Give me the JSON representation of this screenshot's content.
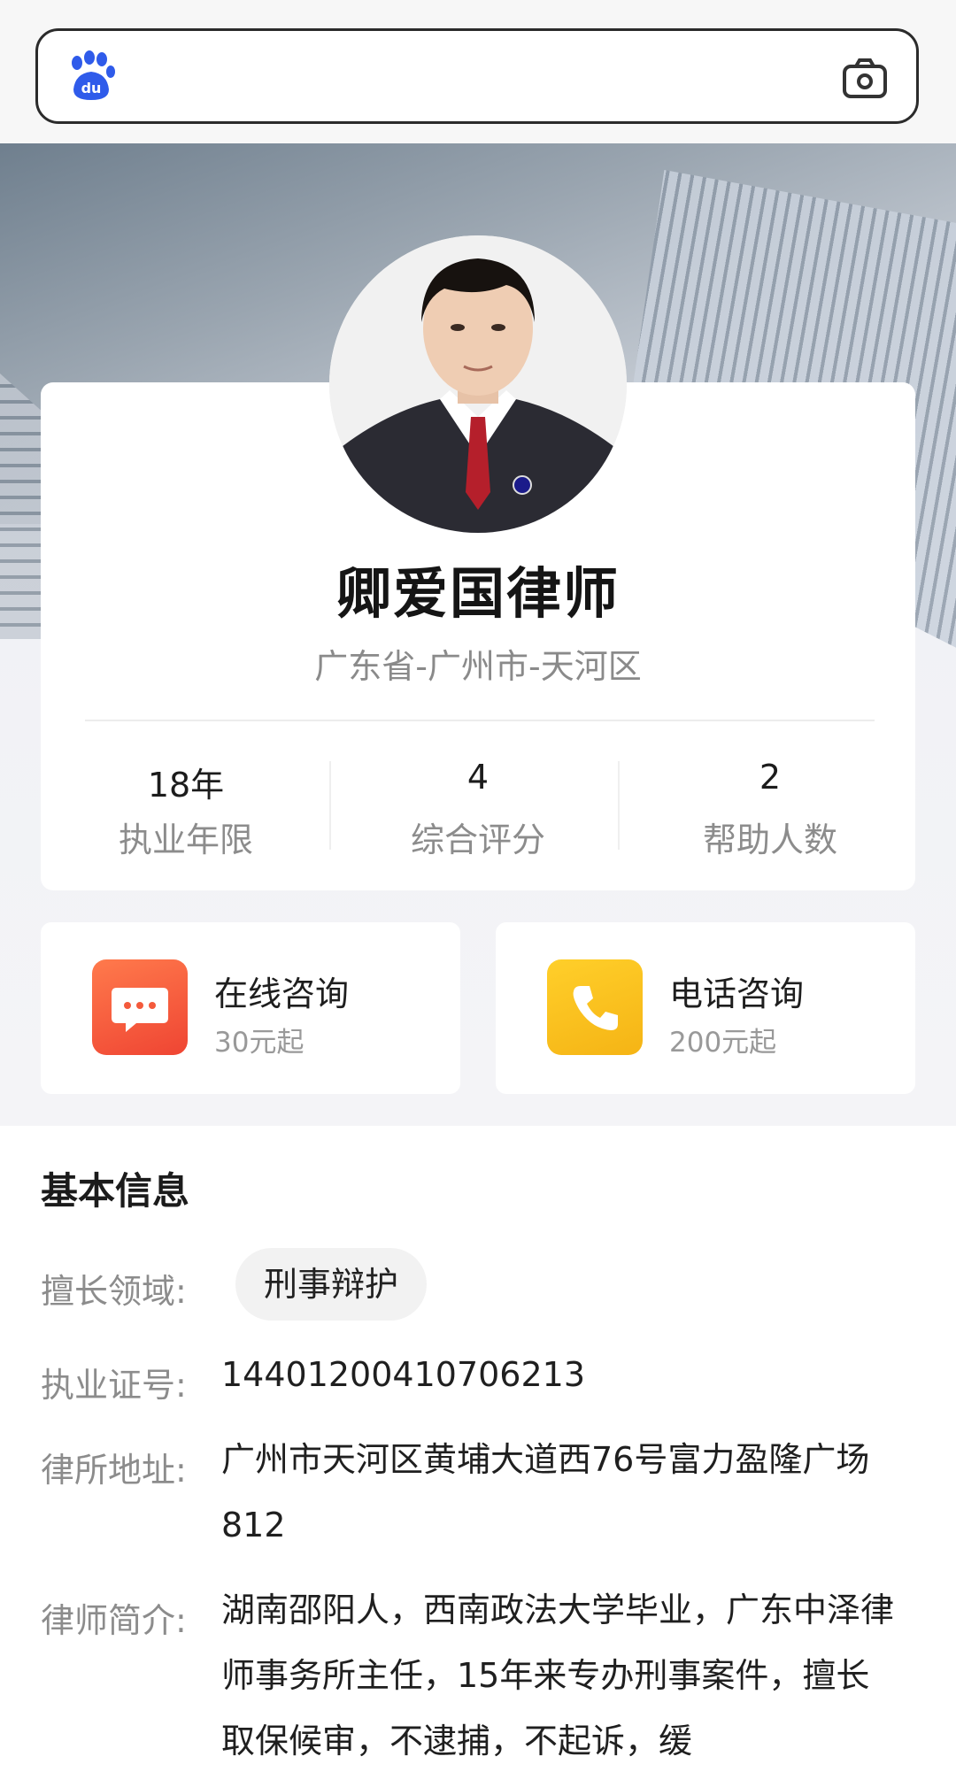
{
  "search": {
    "logo_icon": "baidu-paw-icon",
    "camera_icon": "camera-icon",
    "border_color": "#2b2b2b"
  },
  "profile": {
    "name": "卿爱国律师",
    "region": "广东省-广州市-天河区",
    "stats": [
      {
        "value": "18年",
        "label": "执业年限"
      },
      {
        "value": "4",
        "label": "综合评分"
      },
      {
        "value": "2",
        "label": "帮助人数"
      }
    ]
  },
  "consult": [
    {
      "title": "在线咨询",
      "price": "30元起",
      "icon": "chat-bubble-icon",
      "color": "#f45a3c"
    },
    {
      "title": "电话咨询",
      "price": "200元起",
      "icon": "phone-icon",
      "color": "#f7be1a"
    }
  ],
  "basic_info": {
    "title": "基本信息",
    "field_label": "擅长领域:",
    "field_tag": "刑事辩护",
    "license_label": "执业证号:",
    "license_value": "14401200410706213",
    "address_label": "律所地址:",
    "address_value": "广州市天河区黄埔大道西76号富力盈隆广场812",
    "intro_label": "律师简介:",
    "intro_value": "湖南邵阳人，西南政法大学毕业，广东中泽律师事务所主任，15年来专办刑事案件，擅长取保候审，不逮捕，不起诉，缓"
  }
}
